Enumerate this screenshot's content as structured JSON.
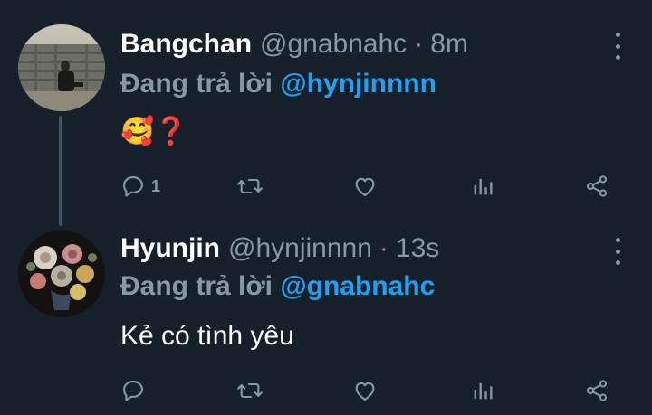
{
  "colors": {
    "background": "#15202b",
    "secondary_text": "#8899a6",
    "mention": "#1da1f2",
    "thread_line": "#3d5466"
  },
  "tweets": [
    {
      "name": "Bangchan",
      "handle": "@gnabnahc",
      "separator": "·",
      "time": "8m",
      "reply_prefix": "Đang trả lời",
      "reply_to": "@hynjinnnn",
      "text": "🥰❓",
      "reply_count": "1",
      "avatar": "avatar-photo-person-on-stone-wall"
    },
    {
      "name": "Hyunjin",
      "handle": "@hynjinnnn",
      "separator": "·",
      "time": "13s",
      "reply_prefix": "Đang trả lời",
      "reply_to": "@gnabnahc",
      "text": "Kẻ có tình yêu",
      "reply_count": "",
      "avatar": "avatar-flower-painting"
    }
  ],
  "icons": [
    "reply-icon",
    "retweet-icon",
    "like-icon",
    "stats-icon",
    "share-icon",
    "more-icon"
  ]
}
